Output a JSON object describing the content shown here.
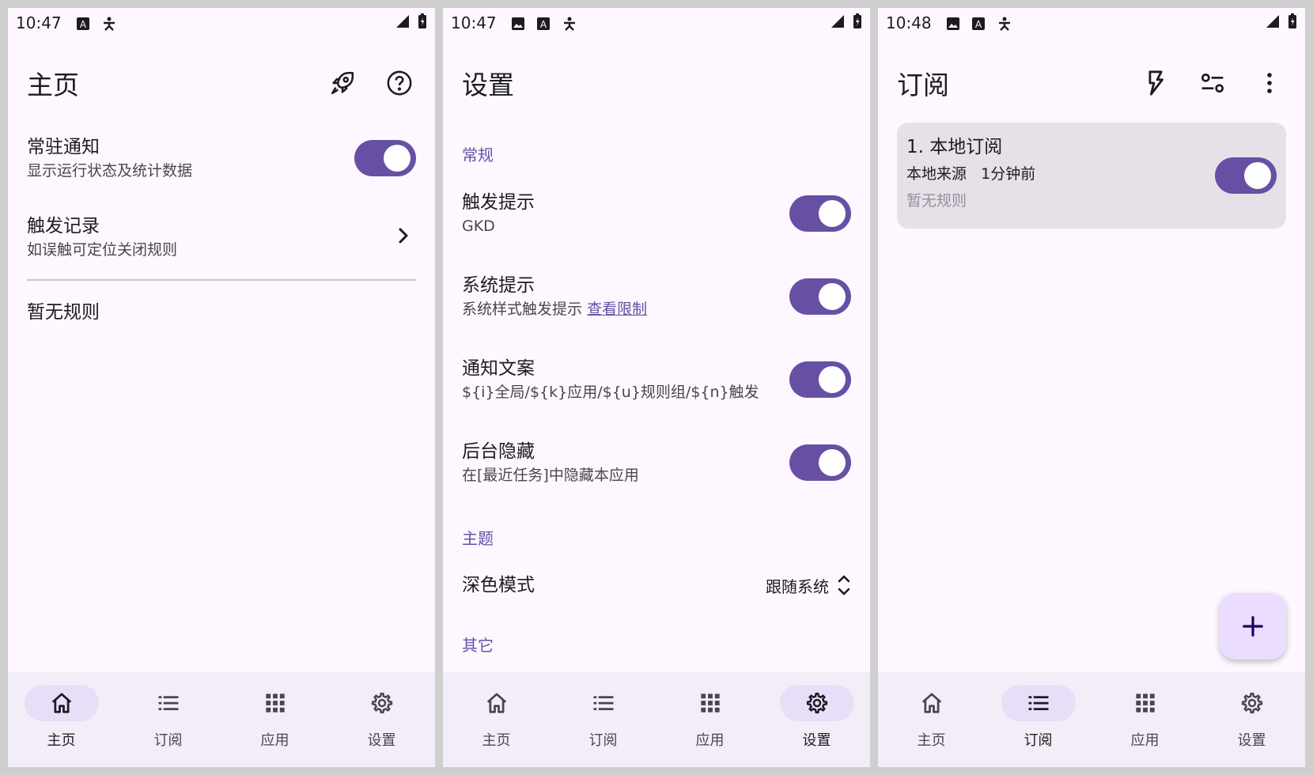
{
  "colors": {
    "primary": "#6750a4",
    "surface": "#fef7ff",
    "nav_bg": "#f3edf7",
    "nav_active": "#e8def8",
    "card_bg": "#e6e0e9",
    "fab_bg": "#eaddff"
  },
  "nav": [
    {
      "label": "主页",
      "icon": "home-icon"
    },
    {
      "label": "订阅",
      "icon": "list-icon"
    },
    {
      "label": "应用",
      "icon": "apps-grid-icon"
    },
    {
      "label": "设置",
      "icon": "gear-icon"
    }
  ],
  "home": {
    "status_time": "10:47",
    "title": "主页",
    "actions": [
      "rocket-icon",
      "help-icon"
    ],
    "items": [
      {
        "title": "常驻通知",
        "subtitle": "显示运行状态及统计数据",
        "toggle": true
      },
      {
        "title": "触发记录",
        "subtitle": "如误触可定位关闭规则"
      }
    ],
    "empty_text": "暂无规则",
    "active_tab": 0
  },
  "settings": {
    "status_time": "10:47",
    "title": "设置",
    "sections": {
      "general": "常规",
      "theme": "主题",
      "other": "其它"
    },
    "items": [
      {
        "title": "触发提示",
        "subtitle": "GKD",
        "toggle": true
      },
      {
        "title": "系统提示",
        "subtitle": "系统样式触发提示",
        "link": "查看限制",
        "toggle": true
      },
      {
        "title": "通知文案",
        "subtitle": "${i}全局/${k}应用/${u}规则组/${n}触发",
        "toggle": true
      },
      {
        "title": "后台隐藏",
        "subtitle": "在[最近任务]中隐藏本应用",
        "toggle": true
      }
    ],
    "dark_mode": {
      "title": "深色模式",
      "value": "跟随系统"
    },
    "active_tab": 3
  },
  "subscriptions": {
    "status_time": "10:48",
    "title": "订阅",
    "actions": [
      "flash-icon",
      "filter-icon",
      "more-vert-icon"
    ],
    "card": {
      "title": "1. 本地订阅",
      "source": "本地来源",
      "time": "1分钟前",
      "rules": "暂无规则",
      "toggle": true
    },
    "fab": "add-icon",
    "active_tab": 1
  }
}
